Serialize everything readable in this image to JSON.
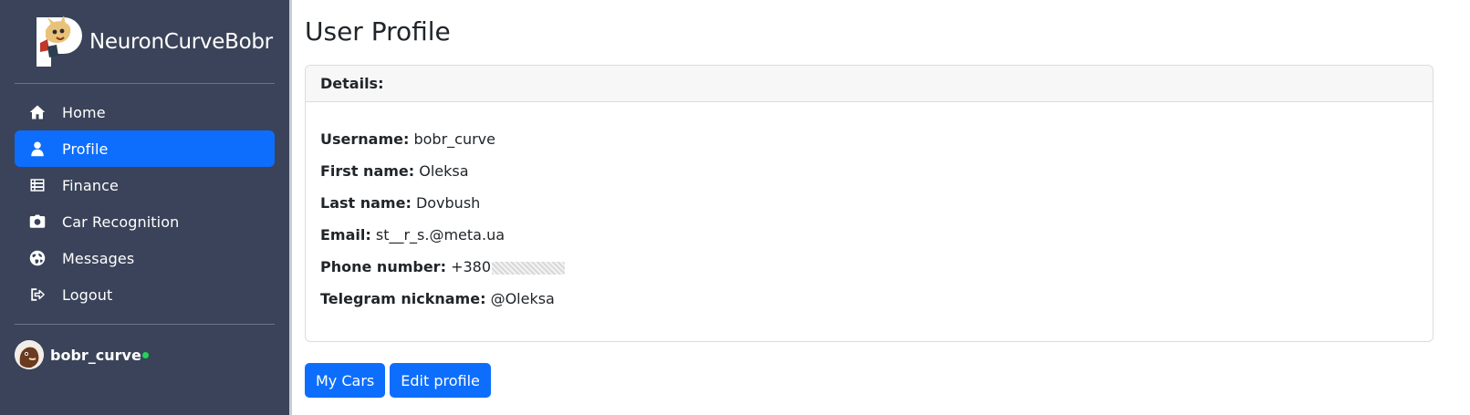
{
  "brand": {
    "title": "NeuronCurveBobr",
    "logo": "bobr-logo"
  },
  "sidebar": {
    "items": [
      {
        "label": "Home",
        "icon": "home-icon",
        "active": false
      },
      {
        "label": "Profile",
        "icon": "user-icon",
        "active": true
      },
      {
        "label": "Finance",
        "icon": "list-icon",
        "active": false
      },
      {
        "label": "Car Recognition",
        "icon": "camera-icon",
        "active": false
      },
      {
        "label": "Messages",
        "icon": "globe-icon",
        "active": false
      },
      {
        "label": "Logout",
        "icon": "logout-icon",
        "active": false
      }
    ],
    "user": {
      "name": "bobr_curve",
      "status": "online"
    }
  },
  "main": {
    "title": "User Profile",
    "card_header": "Details:",
    "fields": {
      "username_label": "Username:",
      "username": "bobr_curve",
      "first_name_label": "First name:",
      "first_name": "Oleksa",
      "last_name_label": "Last name:",
      "last_name": "Dovbush",
      "email_label": "Email:",
      "email": "st__r_s.@meta.ua",
      "phone_label": "Phone number:",
      "phone": "+380",
      "telegram_label": "Telegram nickname:",
      "telegram": "@Oleksa"
    },
    "buttons": {
      "my_cars": "My Cars",
      "edit_profile": "Edit profile"
    }
  },
  "colors": {
    "sidebar_bg": "#3a4359",
    "accent": "#0d6efd",
    "online": "#1fd655"
  }
}
